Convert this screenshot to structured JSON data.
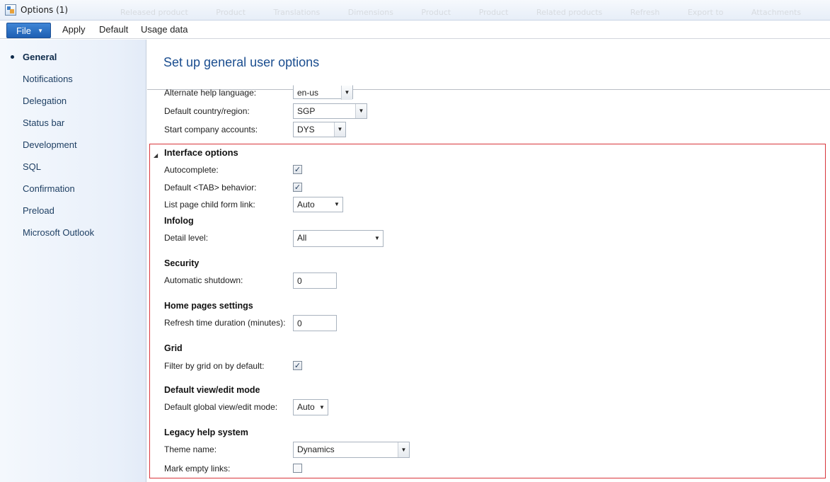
{
  "window": {
    "title": "Options (1)",
    "ribbon_ghost": [
      "Released product",
      "Product",
      "Translations",
      "Dimensions",
      "Product",
      "Product",
      "Related products",
      "Refresh",
      "Export to",
      "Attachments"
    ]
  },
  "menu": {
    "file": "File",
    "items": [
      "Apply",
      "Default",
      "Usage data"
    ]
  },
  "sidebar": {
    "items": [
      "General",
      "Notifications",
      "Delegation",
      "Status bar",
      "Development",
      "SQL",
      "Confirmation",
      "Preload",
      "Microsoft Outlook"
    ],
    "active": "General"
  },
  "main": {
    "heading": "Set up general user options",
    "top_fields": [
      {
        "label": "Alternate help language:",
        "value": "en-us"
      },
      {
        "label": "Default country/region:",
        "value": "SGP"
      },
      {
        "label": "Start company accounts:",
        "value": "DYS"
      }
    ],
    "interface": {
      "title": "Interface options",
      "autocomplete_label": "Autocomplete:",
      "autocomplete_checked": true,
      "tab_label": "Default <TAB> behavior:",
      "tab_checked": true,
      "list_page_label": "List page child form link:",
      "list_page_value": "Auto"
    },
    "infolog": {
      "title": "Infolog",
      "label": "Detail level:",
      "value": "All"
    },
    "security": {
      "title": "Security",
      "label": "Automatic shutdown:",
      "value": "0"
    },
    "home": {
      "title": "Home pages settings",
      "label": "Refresh time duration (minutes):",
      "value": "0"
    },
    "grid": {
      "title": "Grid",
      "label": "Filter by grid on by default:",
      "checked": true
    },
    "view_edit": {
      "title": "Default view/edit mode",
      "label": "Default global view/edit mode:",
      "value": "Auto"
    },
    "legacy": {
      "title": "Legacy help system",
      "theme_label": "Theme name:",
      "theme_value": "Dynamics",
      "empty_links_label": "Mark empty links:",
      "empty_links_checked": false
    }
  },
  "colors": {
    "accent": "#1a4d8f",
    "file_button": "#2a6cc4",
    "highlight_border": "#d8353b"
  }
}
